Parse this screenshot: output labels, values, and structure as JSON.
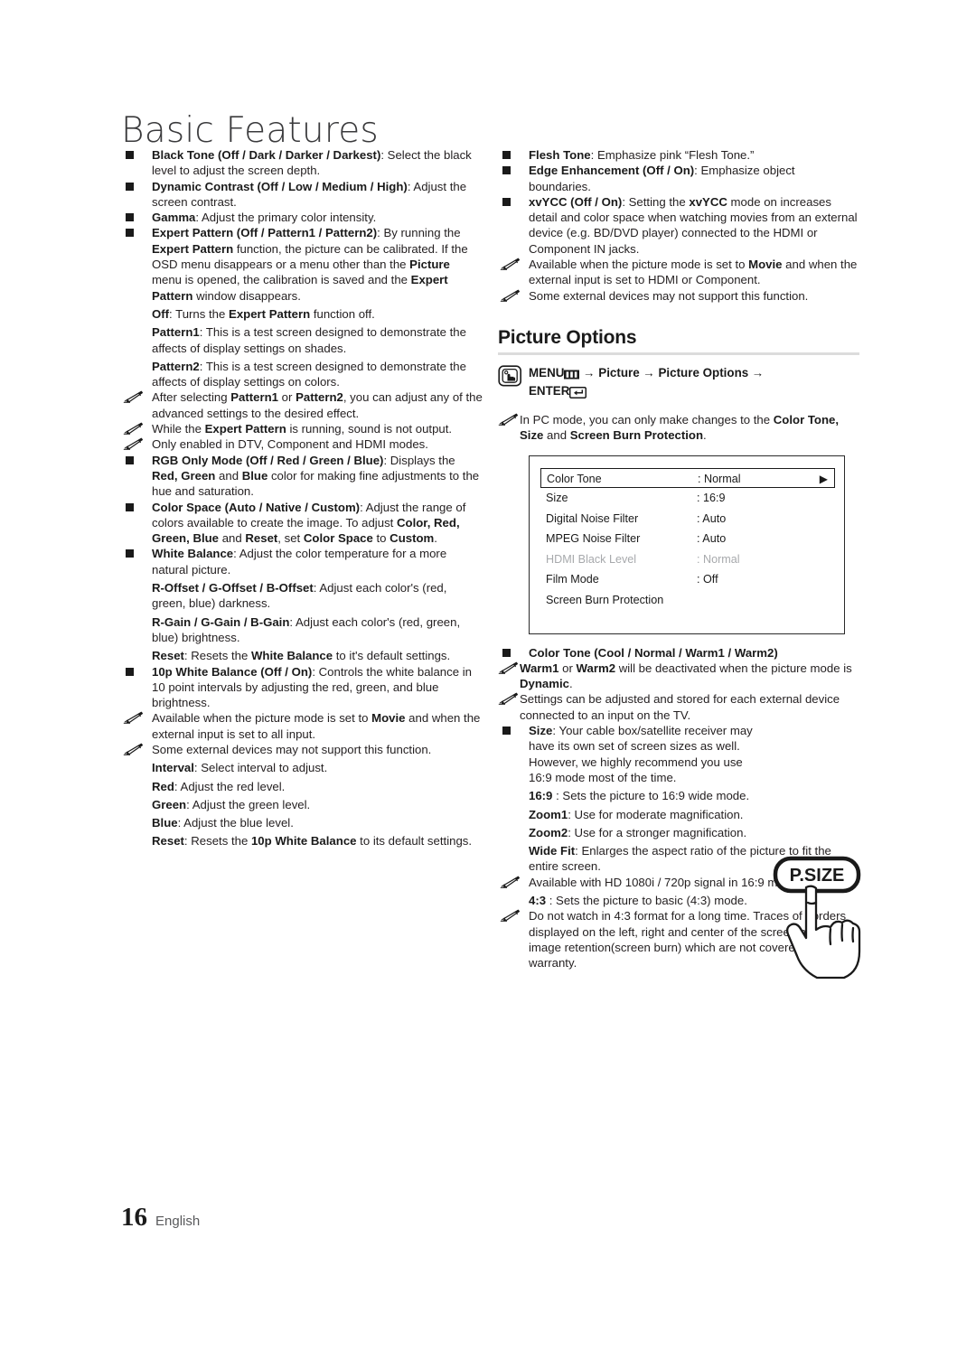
{
  "page": {
    "chapter_title": "Basic Features",
    "footer": {
      "page_number": "16",
      "language": "English"
    }
  },
  "left_column": {
    "items": [
      {
        "type": "square",
        "html": "<b>Black Tone (Off / Dark / Darker / Darkest)</b>: Select the black level to adjust the screen depth."
      },
      {
        "type": "square",
        "html": "<b>Dynamic Contrast (Off / Low / Medium / High)</b>: Adjust the screen contrast."
      },
      {
        "type": "square",
        "html": "<b>Gamma</b>: Adjust the primary color intensity."
      },
      {
        "type": "square",
        "html": "<b>Expert Pattern (Off / Pattern1 / Pattern2)</b>: By running the <b>Expert Pattern</b> function, the picture can be calibrated. If the OSD menu disappears or a menu other than the <b>Picture</b> menu is opened, the calibration is saved and the <b>Expert Pattern</b> window disappears."
      },
      {
        "type": "para",
        "html": "<b>Off</b>: Turns the <b>Expert Pattern</b> function off."
      },
      {
        "type": "para",
        "html": "<b>Pattern1</b>: This is a test screen designed to demonstrate the affects of display settings on shades."
      },
      {
        "type": "para",
        "html": "<b>Pattern2</b>: This is a test screen designed to demonstrate the affects of display settings on colors."
      },
      {
        "type": "note",
        "html": "After selecting <b>Pattern1</b> or <b>Pattern2</b>, you can adjust any of the advanced settings to the desired effect."
      },
      {
        "type": "note",
        "html": "While the <b>Expert Pattern</b> is running, sound is not output."
      },
      {
        "type": "note",
        "html": "Only enabled in DTV, Component and HDMI modes."
      },
      {
        "type": "square",
        "html": "<b>RGB Only Mode (Off / Red / Green / Blue)</b>: Displays the <b>Red, Green</b> and <b>Blue</b> color for making fine adjustments to the hue and saturation."
      },
      {
        "type": "square",
        "html": "<b>Color Space (Auto / Native / Custom)</b>: Adjust the range of colors available to create the image. To adjust <b>Color, Red, Green, Blue</b> and <b>Reset</b>, set <b>Color Space</b> to <b>Custom</b>."
      },
      {
        "type": "square",
        "html": "<b>White Balance</b>: Adjust the color temperature for a more natural picture."
      },
      {
        "type": "para",
        "html": "<b>R-Offset / G-Offset / B-Offset</b>: Adjust each color's (red, green, blue) darkness."
      },
      {
        "type": "para",
        "html": "<b>R-Gain / G-Gain / B-Gain</b>: Adjust each color's (red, green, blue) brightness."
      },
      {
        "type": "para",
        "html": "<b>Reset</b>: Resets the <b>White Balance</b> to it's default settings."
      },
      {
        "type": "square",
        "html": "<b>10p White Balance (Off / On)</b>: Controls the white balance in 10 point intervals by adjusting the red, green, and blue brightness."
      },
      {
        "type": "note",
        "html": "Available when the picture mode is set to <b>Movie</b> and when the external input is set to all input."
      },
      {
        "type": "note",
        "html": "Some external devices may not support this function."
      },
      {
        "type": "para",
        "html": "<b>Interval</b>: Select interval to adjust."
      },
      {
        "type": "para",
        "html": "<b>Red</b>: Adjust the red level."
      },
      {
        "type": "para",
        "html": "<b>Green</b>: Adjust the green level."
      },
      {
        "type": "para",
        "html": "<b>Blue</b>: Adjust the blue level."
      },
      {
        "type": "para",
        "html": "<b>Reset</b>: Resets the <b>10p White Balance</b> to its default settings."
      }
    ]
  },
  "right_column": {
    "items_top": [
      {
        "type": "square",
        "html": "<b>Flesh Tone</b>: Emphasize pink &ldquo;Flesh Tone.&rdquo;"
      },
      {
        "type": "square",
        "html": "<b>Edge Enhancement (Off / On)</b>: Emphasize object boundaries."
      },
      {
        "type": "square",
        "html": "<b>xvYCC (Off / On)</b>: Setting the <b>xvYCC</b> mode on increases detail and color space when watching movies from an external device (e.g. BD/DVD player) connected to the HDMI or Component IN jacks."
      },
      {
        "type": "note",
        "html": "Available when the picture mode is set to <b>Movie</b> and when the external input is set to HDMI or Component."
      },
      {
        "type": "note",
        "html": "Some external devices may not support this function."
      }
    ],
    "section": {
      "heading": "Picture Options",
      "menu_path_prefix": "MENU",
      "menu_path_middle": " &rarr; Picture &rarr; Picture Options &rarr; ",
      "menu_path_enter": "ENTER",
      "pc_note": "In PC mode, you can only make changes to the <b>Color Tone, Size</b> and <b>Screen Burn Protection</b>."
    },
    "osd_menu": {
      "rows": [
        {
          "label": "Color Tone",
          "value": ": Normal",
          "selected": true,
          "dim": false,
          "arrow": "▶"
        },
        {
          "label": "Size",
          "value": ": 16:9",
          "selected": false,
          "dim": false,
          "arrow": ""
        },
        {
          "label": "Digital Noise Filter",
          "value": ": Auto",
          "selected": false,
          "dim": false,
          "arrow": ""
        },
        {
          "label": "MPEG Noise Filter",
          "value": ": Auto",
          "selected": false,
          "dim": false,
          "arrow": ""
        },
        {
          "label": "HDMI Black Level",
          "value": ": Normal",
          "selected": false,
          "dim": true,
          "arrow": ""
        },
        {
          "label": "Film Mode",
          "value": ": Off",
          "selected": false,
          "dim": false,
          "arrow": ""
        },
        {
          "label": "Screen Burn Protection",
          "value": "",
          "selected": false,
          "dim": false,
          "arrow": ""
        }
      ]
    },
    "items_bottom": [
      {
        "type": "square",
        "html": "<b>Color Tone (Cool / Normal / Warm1 / Warm2)</b>"
      },
      {
        "type": "note0",
        "html": "<b>Warm1</b> or <b>Warm2</b> will be deactivated when the picture mode is <b>Dynamic</b>."
      },
      {
        "type": "note0",
        "html": "Settings can be adjusted and stored for each external device connected to an input on the TV."
      },
      {
        "type": "square-narrow",
        "html": "<b>Size</b>: Your cable box/satellite receiver may have its own set of screen sizes as well. However, we highly recommend you use 16:9 mode most of the time."
      },
      {
        "type": "para",
        "html": "<b>16:9</b> : Sets the picture to 16:9 wide mode."
      },
      {
        "type": "para",
        "html": "<b>Zoom1</b>: Use for moderate magnification."
      },
      {
        "type": "para",
        "html": "<b>Zoom2</b>: Use for a stronger magnification."
      },
      {
        "type": "para",
        "html": "<b>Wide Fit</b>: Enlarges the aspect ratio of the picture to fit the entire screen."
      },
      {
        "type": "note",
        "html": "Available with HD 1080i / 720p signal in 16:9 mode."
      },
      {
        "type": "para",
        "html": "<b>4:3</b> : Sets the picture to basic (4:3) mode."
      },
      {
        "type": "note",
        "html": "Do not watch in 4:3 format for a long time. Traces of borders displayed on the left, right and center of the screen may cause image retention(screen burn) which are not covered by the warranty."
      }
    ],
    "remote_button": {
      "label": "P.SIZE"
    }
  }
}
